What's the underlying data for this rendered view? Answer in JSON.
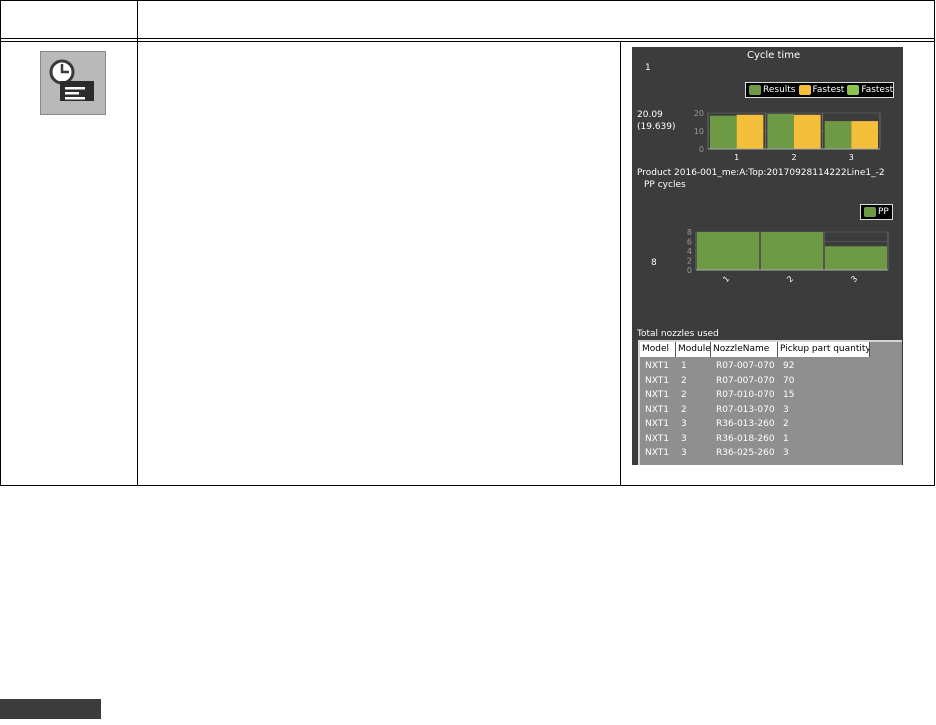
{
  "panel": {
    "cycle_title": "Cycle time",
    "index_label": "1",
    "cycle_value": "20.09",
    "cycle_fastest": "(19.639)",
    "legend": [
      {
        "label": "Results",
        "color": "#6f9a45"
      },
      {
        "label": "Fastest",
        "color": "#f4bf3a"
      },
      {
        "label": "Fastest",
        "color": "#8dc44e"
      }
    ],
    "product_line": "Product 2016-001_me:A:Top:20170928114222Line1_-2",
    "pp_title": "PP cycles",
    "pp_legend": {
      "label": "PP",
      "color": "#6f9a45"
    },
    "pp_value": "8",
    "nozzles_title": "Total nozzles used",
    "nozzles_columns": [
      "Model",
      "Module",
      "NozzleName",
      "Pickup part quantity"
    ],
    "nozzles_rows": [
      [
        "NXT1",
        "1",
        "R07-007-070",
        "92"
      ],
      [
        "NXT1",
        "2",
        "R07-007-070",
        "70"
      ],
      [
        "NXT1",
        "2",
        "R07-010-070",
        "15"
      ],
      [
        "NXT1",
        "2",
        "R07-013-070",
        "3"
      ],
      [
        "NXT1",
        "3",
        "R36-013-260",
        "2"
      ],
      [
        "NXT1",
        "3",
        "R36-018-260",
        "1"
      ],
      [
        "NXT1",
        "3",
        "R36-025-260",
        "3"
      ]
    ]
  },
  "chart_data": [
    {
      "type": "bar",
      "categories": [
        "1",
        "2",
        "3"
      ],
      "series": [
        {
          "name": "Results",
          "values": [
            18.5,
            19.5,
            15.5
          ]
        },
        {
          "name": "Fastest",
          "values": [
            19.0,
            19.0,
            15.5
          ]
        }
      ],
      "title": "Cycle time",
      "ylim": [
        0,
        20
      ],
      "yticks": [
        "0",
        "10",
        "20"
      ]
    },
    {
      "type": "bar",
      "categories": [
        "1",
        "2",
        "3"
      ],
      "series": [
        {
          "name": "PP",
          "values": [
            8,
            8,
            5
          ]
        }
      ],
      "title": "PP cycles",
      "ylim": [
        0,
        8
      ],
      "yticks": [
        "0",
        "2",
        "4",
        "6",
        "8"
      ]
    }
  ]
}
